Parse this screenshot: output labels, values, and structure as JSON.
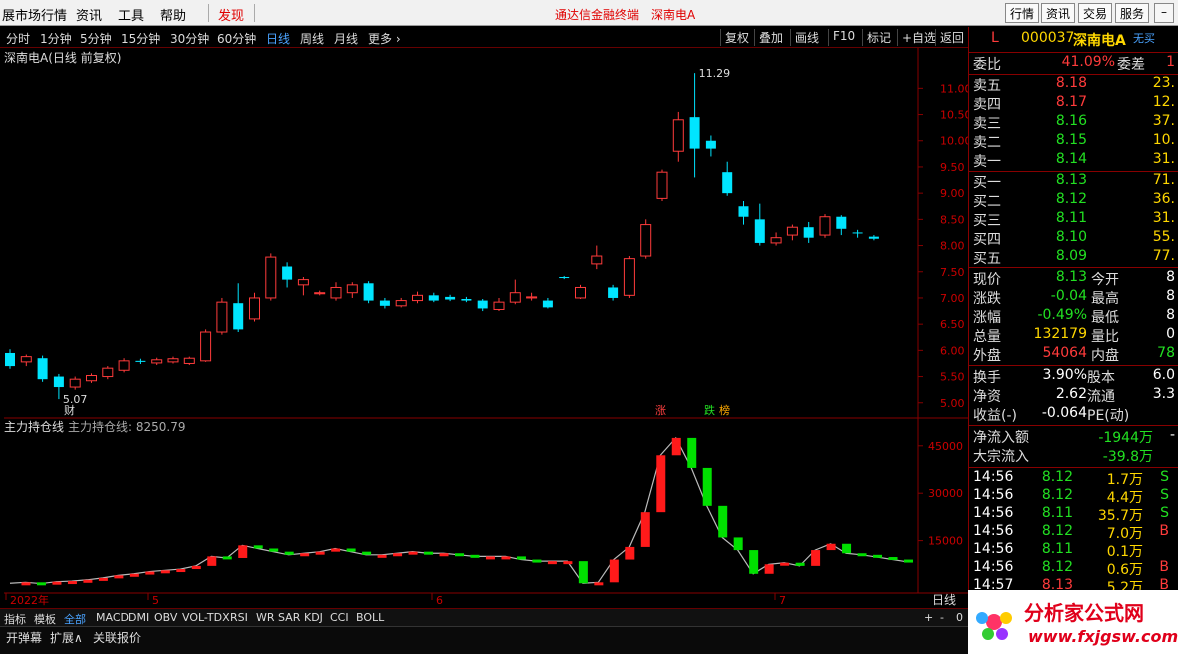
{
  "menu": {
    "items": [
      "展市场行情",
      "资讯",
      "工具",
      "帮助"
    ],
    "discover": "发现",
    "center_links": [
      "通达信金融终端",
      "深南电A"
    ],
    "right_buttons": [
      "行情",
      "资讯",
      "交易",
      "服务"
    ]
  },
  "periods": [
    "分时",
    "1分钟",
    "5分钟",
    "15分钟",
    "30分钟",
    "60分钟",
    "日线",
    "周线",
    "月线",
    "更多 ›"
  ],
  "active_period": "日线",
  "tools": [
    "复权",
    "叠加",
    "画线",
    "F10",
    "标记",
    "+自选",
    "返回"
  ],
  "chart_title": "深南电A(日线 前复权)",
  "price_axis": [
    "11.00",
    "10.50",
    "10.00",
    "9.50",
    "9.00",
    "8.50",
    "8.00",
    "7.50",
    "7.00",
    "6.50",
    "6.00",
    "5.50",
    "5.00"
  ],
  "annotations": {
    "high": "11.29",
    "low": "5.07",
    "cai": "财",
    "zhang": "涨",
    "die": "跌",
    "bang": "榜"
  },
  "indicator": {
    "name": "主力持仓线",
    "label": "主力持仓线: 8250.79",
    "axis": [
      "45000",
      "30000",
      "15000"
    ]
  },
  "date_axis": [
    "2022年",
    "5",
    "6",
    "7"
  ],
  "period_label": "日线",
  "bottom_tabs": [
    "指标",
    "模板",
    "全部",
    "MACD",
    "DMI",
    "OBV",
    "VOL-TDX",
    "RSI",
    "WR",
    "SAR",
    "KDJ",
    "CCI",
    "BOLL"
  ],
  "active_tab": "全部",
  "footer_buttons": [
    "开弹幕",
    "扩展∧",
    "关联报价"
  ],
  "zoom_controls": [
    "+",
    "-",
    "0"
  ],
  "stock": {
    "mark": "L",
    "code": "000037",
    "name": "深南电A",
    "badge": "无买"
  },
  "weibi": {
    "label": "委比",
    "value": "41.09%",
    "label2": "委差",
    "value2": "1"
  },
  "asks": [
    {
      "label": "卖五",
      "price": "8.18",
      "vol": "23."
    },
    {
      "label": "卖四",
      "price": "8.17",
      "vol": "12."
    },
    {
      "label": "卖三",
      "price": "8.16",
      "vol": "37."
    },
    {
      "label": "卖二",
      "price": "8.15",
      "vol": "10."
    },
    {
      "label": "卖一",
      "price": "8.14",
      "vol": "31."
    }
  ],
  "bids": [
    {
      "label": "买一",
      "price": "8.13",
      "vol": "71."
    },
    {
      "label": "买二",
      "price": "8.12",
      "vol": "36."
    },
    {
      "label": "买三",
      "price": "8.11",
      "vol": "31."
    },
    {
      "label": "买四",
      "price": "8.10",
      "vol": "55."
    },
    {
      "label": "买五",
      "price": "8.09",
      "vol": "77."
    }
  ],
  "quote": [
    {
      "l1": "现价",
      "v1": "8.13",
      "l2": "今开",
      "v2": "8"
    },
    {
      "l1": "涨跌",
      "v1": "-0.04",
      "l2": "最高",
      "v2": "8"
    },
    {
      "l1": "涨幅",
      "v1": "-0.49%",
      "l2": "最低",
      "v2": "8"
    },
    {
      "l1": "总量",
      "v1": "132179",
      "l2": "量比",
      "v2": "0"
    },
    {
      "l1": "外盘",
      "v1": "54064",
      "l2": "内盘",
      "v2": "78"
    }
  ],
  "fundamentals": [
    {
      "l1": "换手",
      "v1": "3.90%",
      "l2": "股本",
      "v2": "6.0"
    },
    {
      "l1": "净资",
      "v1": "2.62",
      "l2": "流通",
      "v2": "3.3"
    },
    {
      "l1": "收益(-)",
      "v1": "-0.064",
      "l2": "PE(动)",
      "v2": ""
    }
  ],
  "flow": [
    {
      "label": "净流入额",
      "value": "-1944万",
      "extra": "-"
    },
    {
      "label": "大宗流入",
      "value": "-39.8万",
      "extra": ""
    }
  ],
  "ticks": [
    {
      "time": "14:56",
      "price": "8.12",
      "vol": "1.7万",
      "bs": "S"
    },
    {
      "time": "14:56",
      "price": "8.12",
      "vol": "4.4万",
      "bs": "S"
    },
    {
      "time": "14:56",
      "price": "8.11",
      "vol": "35.7万",
      "bs": "S"
    },
    {
      "time": "14:56",
      "price": "8.12",
      "vol": "7.0万",
      "bs": "B"
    },
    {
      "time": "14:56",
      "price": "8.11",
      "vol": "0.1万",
      "bs": ""
    },
    {
      "time": "14:56",
      "price": "8.12",
      "vol": "0.6万",
      "bs": "B"
    },
    {
      "time": "14:57",
      "price": "8.13",
      "vol": "5.2万",
      "bs": "B"
    }
  ],
  "logo": {
    "text": "分析家公式网",
    "url": "www.fxjgsw.com"
  },
  "candles": [
    [
      5.95,
      5.7,
      6.02,
      5.65
    ],
    [
      5.78,
      5.88,
      5.92,
      5.7
    ],
    [
      5.85,
      5.45,
      5.9,
      5.4
    ],
    [
      5.5,
      5.3,
      5.55,
      5.07
    ],
    [
      5.3,
      5.45,
      5.5,
      5.25
    ],
    [
      5.42,
      5.52,
      5.56,
      5.38
    ],
    [
      5.5,
      5.66,
      5.7,
      5.45
    ],
    [
      5.62,
      5.8,
      5.85,
      5.58
    ],
    [
      5.8,
      5.78,
      5.84,
      5.74
    ],
    [
      5.76,
      5.82,
      5.86,
      5.72
    ],
    [
      5.78,
      5.84,
      5.88,
      5.75
    ],
    [
      5.75,
      5.85,
      5.88,
      5.72
    ],
    [
      5.8,
      6.35,
      6.4,
      5.78
    ],
    [
      6.35,
      6.92,
      7.0,
      6.3
    ],
    [
      6.9,
      6.4,
      7.28,
      6.35
    ],
    [
      6.6,
      7.0,
      7.1,
      6.55
    ],
    [
      7.0,
      7.78,
      7.85,
      6.95
    ],
    [
      7.6,
      7.35,
      7.68,
      7.2
    ],
    [
      7.25,
      7.35,
      7.4,
      7.05
    ],
    [
      7.08,
      7.1,
      7.14,
      7.05
    ],
    [
      7.0,
      7.2,
      7.3,
      6.95
    ],
    [
      7.1,
      7.25,
      7.3,
      7.0
    ],
    [
      7.28,
      6.95,
      7.32,
      6.9
    ],
    [
      6.95,
      6.85,
      7.0,
      6.8
    ],
    [
      6.85,
      6.95,
      7.0,
      6.82
    ],
    [
      6.95,
      7.05,
      7.12,
      6.9
    ],
    [
      7.05,
      6.95,
      7.1,
      6.92
    ],
    [
      7.02,
      6.97,
      7.06,
      6.94
    ],
    [
      6.98,
      6.95,
      7.02,
      6.92
    ],
    [
      6.95,
      6.8,
      6.98,
      6.75
    ],
    [
      6.78,
      6.92,
      7.0,
      6.75
    ],
    [
      6.92,
      7.1,
      7.35,
      6.88
    ],
    [
      7.0,
      7.02,
      7.1,
      6.95
    ],
    [
      6.95,
      6.82,
      7.0,
      6.8
    ],
    [
      7.4,
      7.38,
      7.42,
      7.36
    ],
    [
      7.0,
      7.2,
      7.25,
      6.98
    ],
    [
      7.65,
      7.8,
      8.0,
      7.55
    ],
    [
      7.2,
      7.0,
      7.25,
      6.95
    ],
    [
      7.05,
      7.75,
      7.8,
      7.0
    ],
    [
      7.8,
      8.4,
      8.5,
      7.75
    ],
    [
      8.9,
      9.4,
      9.45,
      8.85
    ],
    [
      9.8,
      10.4,
      10.55,
      9.6
    ],
    [
      10.45,
      9.85,
      11.29,
      9.3
    ],
    [
      10.0,
      9.85,
      10.1,
      9.7
    ],
    [
      9.4,
      9.0,
      9.6,
      8.95
    ],
    [
      8.75,
      8.55,
      8.85,
      8.4
    ],
    [
      8.5,
      8.05,
      8.8,
      8.0
    ],
    [
      8.05,
      8.15,
      8.25,
      8.0
    ],
    [
      8.2,
      8.35,
      8.4,
      8.1
    ],
    [
      8.35,
      8.15,
      8.45,
      8.05
    ],
    [
      8.2,
      8.55,
      8.6,
      8.15
    ],
    [
      8.55,
      8.32,
      8.58,
      8.2
    ],
    [
      8.25,
      8.24,
      8.3,
      8.15
    ],
    [
      8.17,
      8.13,
      8.2,
      8.1
    ]
  ],
  "indicator_values": [
    1500,
    1800,
    1400,
    2000,
    2200,
    2600,
    3200,
    4000,
    4500,
    5200,
    5600,
    6000,
    7000,
    10000,
    9500,
    13500,
    12500,
    11500,
    10500,
    11000,
    11500,
    12500,
    11500,
    10500,
    10500,
    11000,
    11500,
    11000,
    11000,
    10500,
    10000,
    10000,
    10000,
    9000,
    8500,
    8500,
    8500,
    1500,
    1800,
    9000,
    13000,
    24000,
    42000,
    47500,
    38000,
    26000,
    16000,
    12000,
    4500,
    7500,
    8000,
    7000,
    12000,
    14000,
    11000,
    10500,
    9800,
    9000,
    8250
  ]
}
